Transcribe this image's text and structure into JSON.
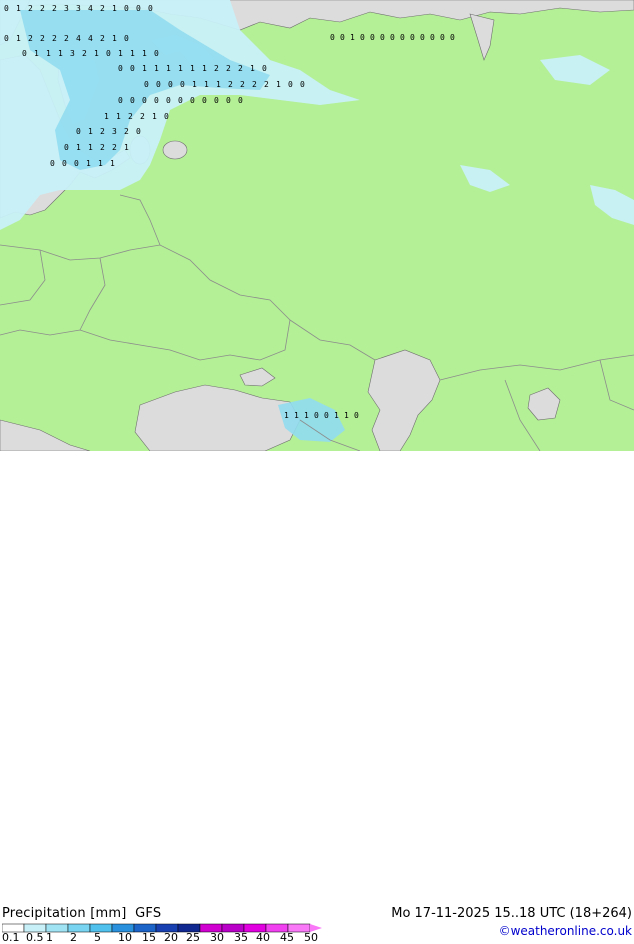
{
  "header": {
    "title": "Precipitation [mm]",
    "model": "GFS",
    "valid_time": "Mo 17-11-2025 15..18 UTC (18+264)",
    "credit": "©weatheronline.co.uk"
  },
  "legend": {
    "values": [
      "0.1",
      "0.5",
      "1",
      "2",
      "5",
      "10",
      "15",
      "20",
      "25",
      "30",
      "35",
      "40",
      "45",
      "50"
    ],
    "colors": [
      "#ffffff",
      "#c8f0f8",
      "#a0e4f4",
      "#78d4f0",
      "#50c0ec",
      "#2890dc",
      "#1c64c8",
      "#1840b0",
      "#102890",
      "#d000d0",
      "#b800c8",
      "#e000e0",
      "#f040f0",
      "#f878f8"
    ]
  },
  "colors": {
    "land": "#b4f096",
    "sea": "#dcdcdc",
    "precip_light": "#c8f0f8",
    "precip_mid": "#90dcf0",
    "border": "#8c8c8c",
    "coast": "#6e6e6e"
  },
  "map_labels": {
    "row1": [
      "0",
      "1",
      "2",
      "2",
      "2",
      "3",
      "3",
      "4",
      "2",
      "1",
      "0",
      "0",
      "0"
    ],
    "row2": [
      "0",
      "1",
      "2",
      "2",
      "2",
      "2",
      "4",
      "4",
      "2",
      "1",
      "0"
    ],
    "row3": [
      "0",
      "1",
      "1",
      "1",
      "3",
      "2",
      "1",
      "0",
      "1",
      "1",
      "1",
      "0"
    ],
    "row4": [
      "0",
      "0",
      "1",
      "1",
      "1",
      "1",
      "1",
      "1",
      "2",
      "2",
      "2",
      "1",
      "0"
    ],
    "row5": [
      "0",
      "0",
      "0",
      "0",
      "1",
      "1",
      "1",
      "2",
      "2",
      "2",
      "2",
      "1",
      "0",
      "0"
    ],
    "row6": [
      "0",
      "0",
      "0",
      "0",
      "0",
      "0",
      "0",
      "0",
      "0",
      "0",
      "0"
    ],
    "row7": [
      "1",
      "1",
      "2",
      "2",
      "1",
      "0"
    ],
    "row8": [
      "0",
      "1",
      "2",
      "3",
      "2",
      "0"
    ],
    "row9": [
      "0",
      "1",
      "1",
      "2",
      "2",
      "1"
    ],
    "row10": [
      "0",
      "0",
      "0",
      "1",
      "1",
      "1"
    ],
    "caucasus": [
      "1",
      "1",
      "1",
      "0",
      "0",
      "1",
      "1",
      "0"
    ],
    "east": [
      "0",
      "0",
      "1",
      "0",
      "0",
      "0",
      "0",
      "0",
      "0",
      "0",
      "0",
      "0",
      "0"
    ]
  }
}
